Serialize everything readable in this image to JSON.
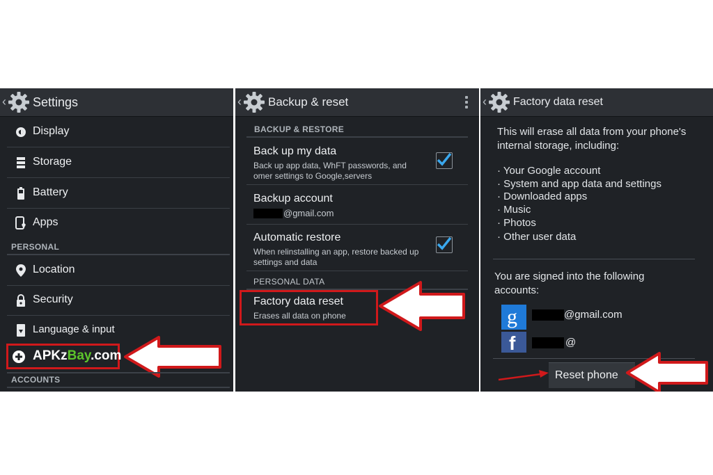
{
  "settings": {
    "title": "Settings",
    "items": [
      {
        "label": "Display",
        "icon": "brightness-icon"
      },
      {
        "label": "Storage",
        "icon": "storage-icon"
      },
      {
        "label": "Battery",
        "icon": "battery-icon"
      },
      {
        "label": "Apps",
        "icon": "apps-icon"
      }
    ],
    "section_personal": "PERSONAL",
    "personal_items": [
      {
        "label": "Location",
        "icon": "location-pin-icon"
      },
      {
        "label": "Security",
        "icon": "lock-icon"
      },
      {
        "label": "Language & input",
        "icon": "keyboard-icon"
      }
    ],
    "brand_part1": "APKz",
    "brand_part2": "Bay",
    "brand_part3": ".com",
    "section_accounts": "ACCOUNTS"
  },
  "backup": {
    "title": "Backup & reset",
    "section_backup": "BACKUP & RESTORE",
    "backup_my_data": {
      "title": "Back up my data",
      "desc": "Back up app data, WhFT passwords, and omer settings to Google,servers",
      "checked": true
    },
    "backup_account": {
      "title": "Backup account",
      "value": "@gmail.com"
    },
    "automatic_restore": {
      "title": "Automatic restore",
      "desc": "When relinstalling an app, restore backed up settings and data",
      "checked": true
    },
    "section_personal": "PERSONAL DATA",
    "factory_reset": {
      "title": "Factory data reset",
      "desc": "Erases all data on phone"
    }
  },
  "factory": {
    "title": "Factory data reset",
    "intro": "This will erase all data from your phone's internal storage, including:",
    "bullets": [
      "· Your Google account",
      "· System and app data and settings",
      "· Downloaded apps",
      "· Music",
      "· Photos",
      "· Other user data"
    ],
    "signed_in": "You are signed into the following accounts:",
    "accounts": [
      {
        "icon": "google-icon",
        "text": "@gmail.com"
      },
      {
        "icon": "facebook-icon",
        "text": "@"
      }
    ],
    "reset_button": "Reset phone"
  },
  "colors": {
    "highlight": "#d0191b",
    "accent_green": "#5cc52b",
    "check_blue": "#3aa8ee"
  }
}
